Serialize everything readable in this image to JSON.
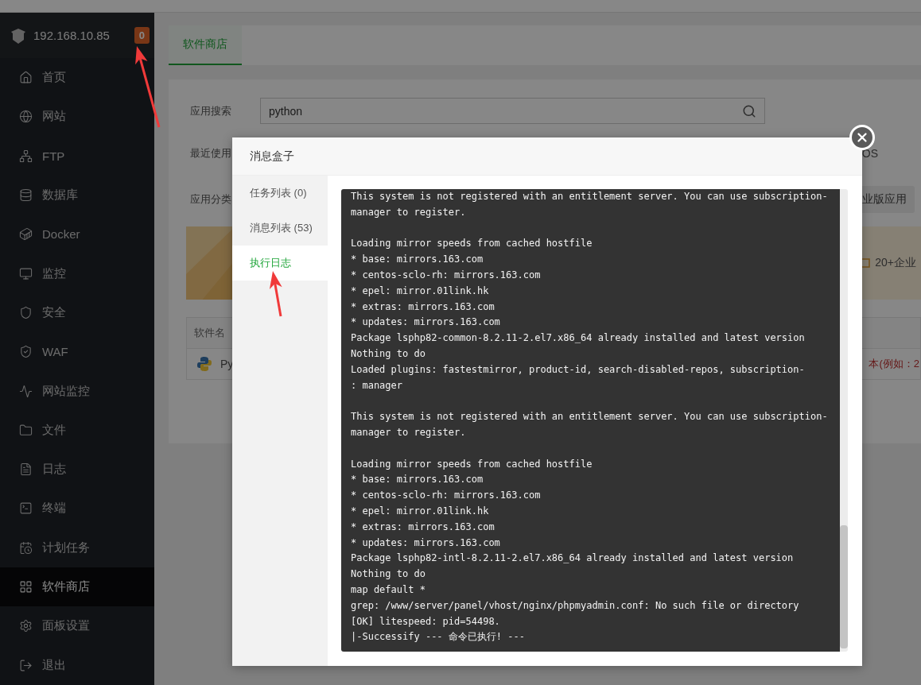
{
  "sidebar": {
    "server": "192.168.10.85",
    "badge": "0",
    "items": [
      {
        "label": "首页",
        "selected": false
      },
      {
        "label": "网站",
        "selected": false
      },
      {
        "label": "FTP",
        "selected": false
      },
      {
        "label": "数据库",
        "selected": false
      },
      {
        "label": "Docker",
        "selected": false
      },
      {
        "label": "监控",
        "selected": false
      },
      {
        "label": "安全",
        "selected": false
      },
      {
        "label": "WAF",
        "selected": false
      },
      {
        "label": "网站监控",
        "selected": false
      },
      {
        "label": "文件",
        "selected": false
      },
      {
        "label": "日志",
        "selected": false
      },
      {
        "label": "终端",
        "selected": false
      },
      {
        "label": "计划任务",
        "selected": false
      },
      {
        "label": "软件商店",
        "selected": true
      },
      {
        "label": "面板设置",
        "selected": false
      },
      {
        "label": "退出",
        "selected": false
      }
    ]
  },
  "tabs": [
    {
      "label": "软件商店",
      "selected": true
    }
  ],
  "store": {
    "search_label": "应用搜索",
    "search_value": "python",
    "recent_label": "最近使用",
    "recent_item": "OS",
    "category_label": "应用分类",
    "category_button": "业版应用",
    "banner_text": "20+企业",
    "table": {
      "columns": [
        "软件名"
      ],
      "rows": [
        {
          "name": "Py",
          "note": "本(例如：2"
        }
      ]
    }
  },
  "modal": {
    "title": "消息盒子",
    "nav": [
      {
        "label": "任务列表 (0)",
        "selected": false
      },
      {
        "label": "消息列表 (53)",
        "selected": false
      },
      {
        "label": "执行日志",
        "selected": true
      }
    ],
    "log_blocks": [
      {
        "lines": [
          "This system is not registered with an entitlement server. You can use subscription-",
          "manager to register."
        ]
      },
      {
        "lines": [
          "Loading mirror speeds from cached hostfile",
          "* base: mirrors.163.com",
          "* centos-sclo-rh: mirrors.163.com",
          "* epel: mirror.01link.hk",
          "* extras: mirrors.163.com",
          "* updates: mirrors.163.com",
          "Package lsphp82-common-8.2.11-2.el7.x86_64 already installed and latest version",
          "Nothing to do",
          "Loaded plugins: fastestmirror, product-id, search-disabled-repos, subscription-",
          ": manager"
        ]
      },
      {
        "lines": [
          "This system is not registered with an entitlement server. You can use subscription-",
          "manager to register."
        ]
      },
      {
        "lines": [
          "Loading mirror speeds from cached hostfile",
          "* base: mirrors.163.com",
          "* centos-sclo-rh: mirrors.163.com",
          "* epel: mirror.01link.hk",
          "* extras: mirrors.163.com",
          "* updates: mirrors.163.com",
          "Package lsphp82-intl-8.2.11-2.el7.x86_64 already installed and latest version",
          "Nothing to do",
          "map default *",
          "grep: /www/server/panel/vhost/nginx/phpmyadmin.conf: No such file or directory",
          "[OK] litespeed: pid=54498.",
          "|-Successify --- 命令已执行! ---"
        ]
      }
    ]
  }
}
